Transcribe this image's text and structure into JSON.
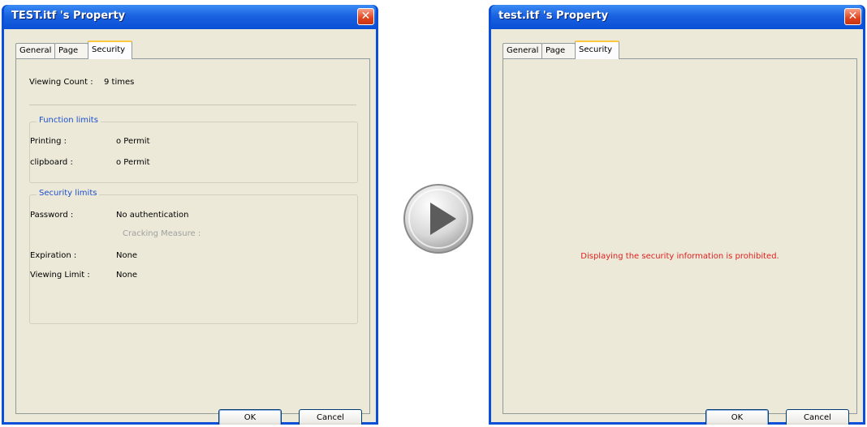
{
  "dialog_left": {
    "title": "TEST.itf 's Property",
    "tabs": [
      "General",
      "Page",
      "Security"
    ],
    "viewing_count_label": "Viewing Count :",
    "viewing_count_value": "9 times",
    "function_limits": {
      "legend": "Function limits",
      "printing_label": "Printing :",
      "printing_value": "o Permit",
      "clipboard_label": "clipboard :",
      "clipboard_value": "o Permit"
    },
    "security_limits": {
      "legend": "Security limits",
      "password_label": "Password :",
      "password_value": "No authentication",
      "cracking_measure": "Cracking Measure :",
      "expiration_label": "Expiration :",
      "expiration_value": "None",
      "viewing_limit_label": "Viewing Limit :",
      "viewing_limit_value": "None"
    },
    "ok_label": "OK",
    "cancel_label": "Cancel"
  },
  "dialog_right": {
    "title": "test.itf 's Property",
    "tabs": [
      "General",
      "Page",
      "Security"
    ],
    "message": "Displaying the security information is prohibited.",
    "ok_label": "OK",
    "cancel_label": "Cancel"
  },
  "icons": {
    "close": "close-icon",
    "play": "play-icon"
  },
  "colors": {
    "titlebar": "#0a4fd6",
    "client": "#ece9d8",
    "legend_text": "#1c4fd0",
    "message_text": "#e02020",
    "close_button": "#e0431e"
  }
}
